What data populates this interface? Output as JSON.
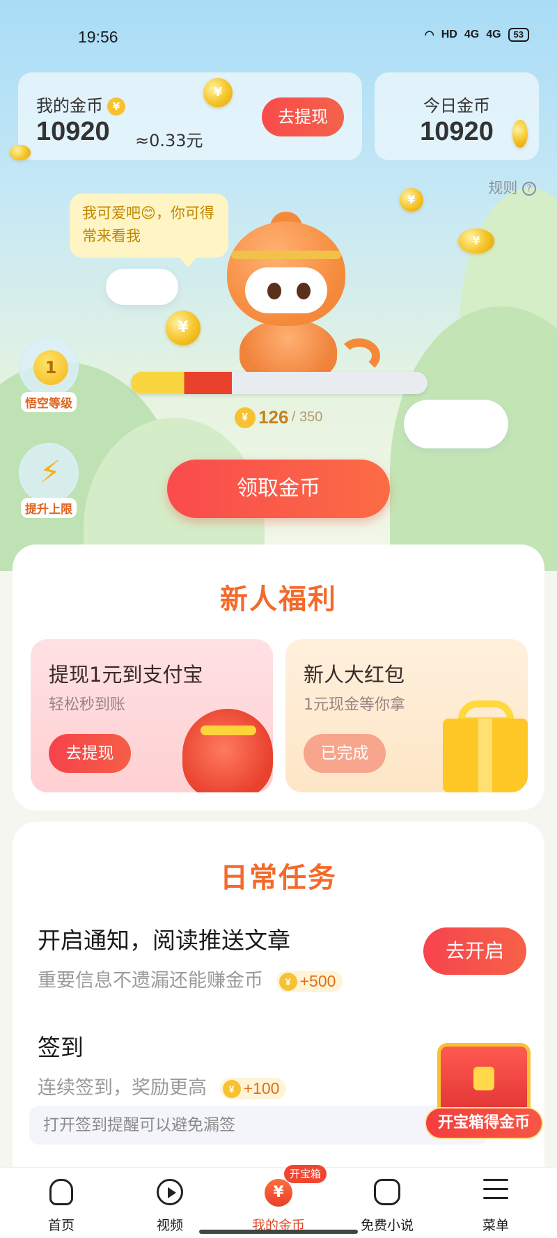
{
  "status_bar": {
    "time": "19:56",
    "network_1": "4G",
    "network_2": "4G",
    "hd": "HD",
    "battery": "53"
  },
  "coins": {
    "my_label": "我的金币",
    "my_value": "10920",
    "approx": "≈0.33元",
    "withdraw_label": "去提现",
    "today_label": "今日金币",
    "today_value": "10920"
  },
  "rules_label": "规则",
  "bubble_text": "我可爱吧😊，你可得常来看我",
  "progress": {
    "current": "126",
    "total": "/ 350"
  },
  "side": {
    "level_value": "1",
    "level_label": "悟空等级",
    "boost_label": "提升上限"
  },
  "claim_label": "领取金币",
  "newbie": {
    "title": "新人福利",
    "cards": [
      {
        "title": "提现1元到支付宝",
        "subtitle": "轻松秒到账",
        "button": "去提现"
      },
      {
        "title": "新人大红包",
        "subtitle": "1元现金等你拿",
        "button": "已完成"
      }
    ]
  },
  "daily": {
    "title": "日常任务",
    "tasks": [
      {
        "title": "开启通知，阅读推送文章",
        "subtitle": "重要信息不遗漏还能赚金币",
        "reward": "+500",
        "button": "去开启"
      },
      {
        "title": "签到",
        "subtitle": "连续签到，奖励更高",
        "reward": "+100"
      }
    ],
    "hint": "打开签到提醒可以避免漏签"
  },
  "chest_label": "开宝箱得金币",
  "tabbar": {
    "items": [
      {
        "label": "首页",
        "icon": "home-icon"
      },
      {
        "label": "视频",
        "icon": "video-play-icon"
      },
      {
        "label": "我的金币",
        "icon": "coin-icon",
        "badge": "开宝箱"
      },
      {
        "label": "免费小说",
        "icon": "book-icon"
      },
      {
        "label": "菜单",
        "icon": "menu-icon"
      }
    ]
  },
  "colors": {
    "accent_red": "#f94b4b",
    "title_orange": "#f36a2b",
    "coin_gold": "#f6c232"
  }
}
